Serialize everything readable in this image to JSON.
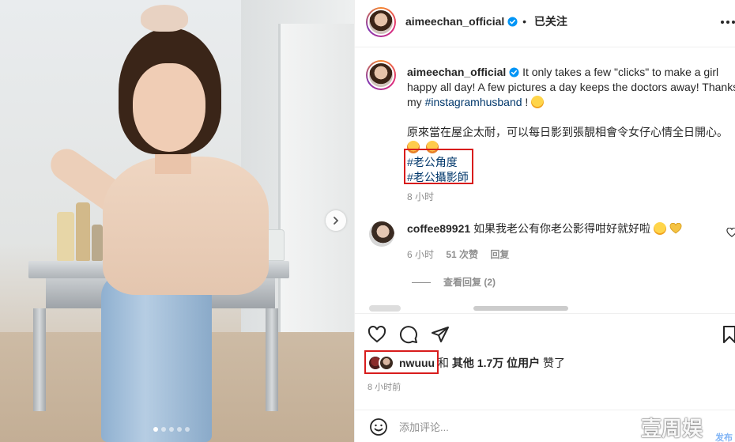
{
  "post": {
    "username": "aimeechan_official",
    "follow_status": "已关注",
    "separator": "•"
  },
  "caption": {
    "username": "aimeechan_official",
    "line1": "It only takes a few \"clicks\" to make a girl",
    "line2": "happy all day! A few pictures a day keeps the doctors away! Thanks",
    "line3_prefix": "my ",
    "line3_tag": "#instagramhusband",
    "line3_suffix": " ! ",
    "line4": "原來當在屋企太耐，可以每日影到張靚相會令女仔心情全日開心。",
    "tag1": "#老公角度",
    "tag2": "#老公攝影師",
    "time": "8 小时"
  },
  "comment": {
    "username": "coffee89921",
    "text": "如果我老公有你老公影得咁好就好啦",
    "time": "6 小时",
    "likes": "51 次赞",
    "reply": "回复",
    "view_replies": "查看回复 (2)"
  },
  "likes": {
    "first_liker": "nwuuu",
    "conjunction": "和",
    "others": "其他 1.7万 位用户",
    "suffix": "赞了"
  },
  "post_time": "8 小时前",
  "comment_input": {
    "placeholder": "添加评论...",
    "post_label": "发布"
  },
  "watermark": "壹周娱",
  "carousel": {
    "total": 5,
    "active": 1
  },
  "colors": {
    "link": "#00376b",
    "verified": "#0095f6",
    "highlight": "#d81c1c",
    "muted": "#8e8e8e"
  },
  "icons": [
    "more-icon",
    "verified-icon",
    "heart-icon",
    "comment-icon",
    "share-icon",
    "bookmark-icon",
    "smile-icon",
    "chevron-right-icon"
  ]
}
